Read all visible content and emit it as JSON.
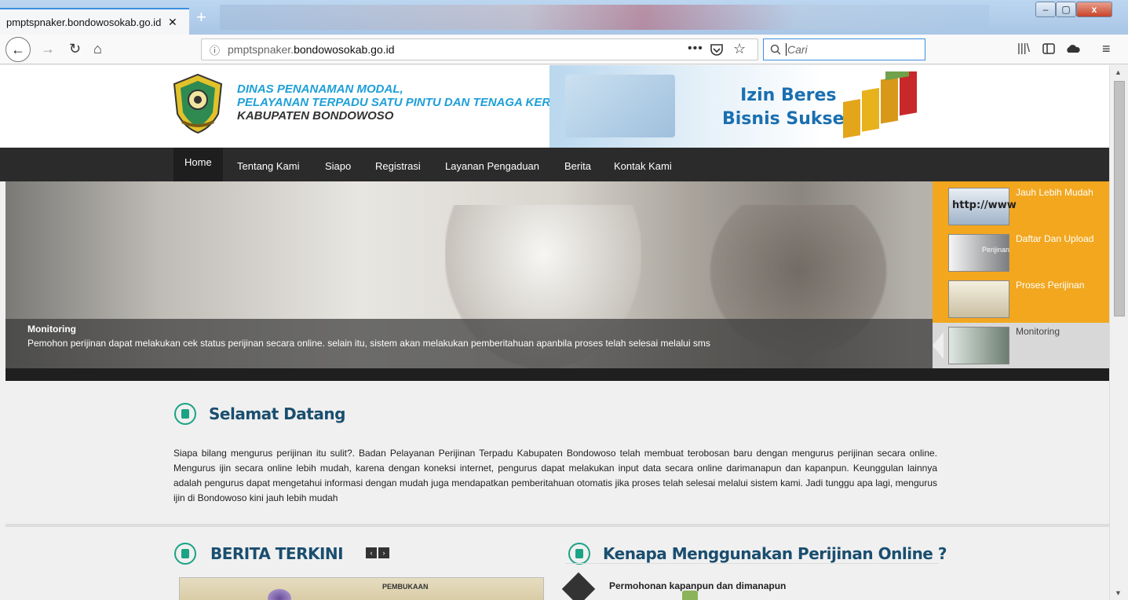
{
  "browser": {
    "tab_title": "pmptspnaker.bondowosokab.go.id",
    "tab_close": "✕",
    "new_tab": "+",
    "url_prefix": "pmptspnaker.",
    "url_domain": "bondowosokab.go.id",
    "url_more": "•••",
    "search_placeholder": "Cari",
    "window_controls": {
      "minimize": "–",
      "maximize": "▢",
      "close": "x"
    }
  },
  "header": {
    "org_line1": "DINAS PENANAMAN MODAL,",
    "org_line2": "PELAYANAN TERPADU SATU PINTU DAN TENAGA KERJA",
    "org_line3": "KABUPATEN BONDOWOSO",
    "tagline1": "Izin Beres",
    "tagline2": "Bisnis Sukses"
  },
  "menu": [
    {
      "label": "Home",
      "active": true
    },
    {
      "label": "Tentang Kami"
    },
    {
      "label": "Siapo"
    },
    {
      "label": "Registrasi"
    },
    {
      "label": "Layanan Pengaduan"
    },
    {
      "label": "Berita"
    },
    {
      "label": "Kontak Kami"
    }
  ],
  "slider": {
    "caption_title": "Monitoring",
    "caption_text": "Pemohon perijinan dapat melakukan cek status perijinan secara online. selain itu, sistem akan melakukan pemberitahuan apanbila proses telah selesai melalui sms",
    "thumbs": [
      {
        "label": "Jauh Lebih Mudah",
        "image_text": "http://www"
      },
      {
        "label": "Daftar Dan Upload",
        "image_text": "Perijinan"
      },
      {
        "label": "Proses Perijinan"
      },
      {
        "label": "Monitoring",
        "active": true
      }
    ]
  },
  "welcome": {
    "title": "Selamat Datang",
    "text": "Siapa bilang mengurus perijinan itu sulit?. Badan Pelayanan Perijinan Terpadu Kabupaten Bondowoso telah membuat terobosan baru dengan mengurus perijinan secara online. Mengurus ijin secara online lebih mudah, karena dengan koneksi internet, pengurus dapat melakukan input data secara online darimanapun dan kapanpun. Keunggulan lainnya adalah pengurus dapat mengetahui informasi dengan mudah juga mendapatkan pemberitahuan otomatis jika proses telah selesai melalui sistem kami. Jadi tunggu apa lagi, mengurus ijin di Bondowoso kini jauh lebih mudah"
  },
  "news": {
    "title": "BERITA TERKINI",
    "prev": "‹",
    "next": "›",
    "image_text": "PEMBUKAAN"
  },
  "why": {
    "title": "Kenapa Menggunakan Perijinan Online ?",
    "items": [
      "Permohonan kapanpun dan dimanapun"
    ]
  },
  "colors": {
    "accent_blue": "#1d9fd8",
    "menu_bg": "#2b2b2b",
    "thumb_bg": "#f2a71f",
    "section_title": "#1a4e6f",
    "section_icon": "#1aa385"
  },
  "icons": {
    "back": "back-arrow-icon",
    "forward": "forward-arrow-icon",
    "reload": "reload-icon",
    "home": "home-icon",
    "info": "info-icon",
    "pocket": "pocket-icon",
    "bookmark": "star-icon",
    "search": "search-icon",
    "library": "library-icon",
    "sidebar": "sidebar-icon",
    "sync": "sync-icon",
    "menu": "hamburger-menu-icon"
  }
}
